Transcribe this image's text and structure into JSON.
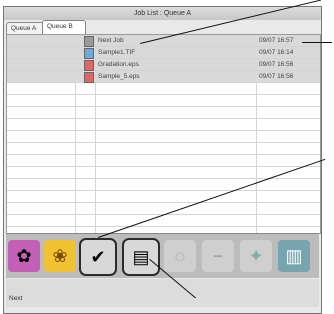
{
  "window": {
    "title": "Job List : Queue A"
  },
  "tabs": [
    {
      "label": "Queue A"
    },
    {
      "label": "Queue B"
    }
  ],
  "jobs": [
    {
      "name": "Next Job",
      "time": "09/07 16:57"
    },
    {
      "name": "Sample1.TIF",
      "time": "09/07 16:14"
    },
    {
      "name": "Gradation.eps",
      "time": "09/07 16:56"
    },
    {
      "name": "Sample_5.eps",
      "time": "09/07 16:56"
    }
  ],
  "toolbar": {
    "buttons": [
      {
        "icon": "flower-image-icon"
      },
      {
        "icon": "sunflower-icon"
      },
      {
        "icon": "checkmark-queue-icon"
      },
      {
        "icon": "scanner-icon"
      },
      {
        "icon": "disabled-tool-icon"
      },
      {
        "icon": "minus-icon"
      },
      {
        "icon": "sparkle-icon"
      },
      {
        "icon": "bucket-icon"
      }
    ]
  },
  "status": {
    "text": "Next"
  },
  "colors": {
    "selected_row": "#d9d9d9",
    "toolbar": "#bcbcbc",
    "frame": "#777777"
  }
}
